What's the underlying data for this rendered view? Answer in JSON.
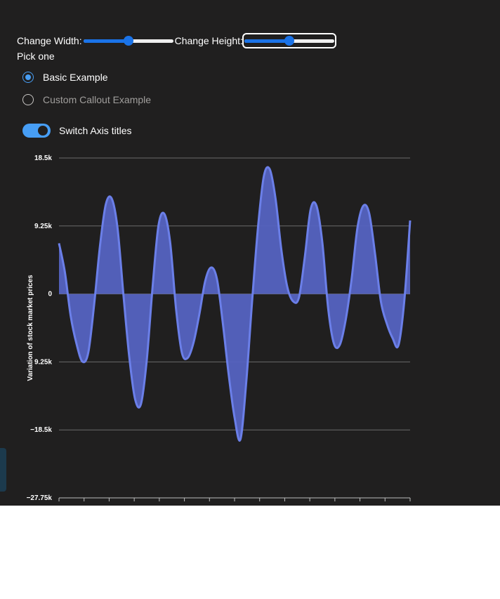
{
  "controls": {
    "width_label": "Change Width:",
    "height_label": "Change Height:",
    "width_value": 0.5,
    "height_value": 0.5
  },
  "pick_label": "Pick one",
  "options": [
    {
      "label": "Basic Example",
      "selected": true
    },
    {
      "label": "Custom Callout Example",
      "selected": false
    }
  ],
  "toggle": {
    "label": "Switch Axis titles",
    "on": true
  },
  "colors": {
    "background": "#201f1f",
    "accent": "#479ef5",
    "series_line": "#6b7fe8",
    "series_fill": "#5563c1",
    "gridline": "#6a6a6a"
  },
  "chart_data": {
    "type": "area",
    "title": "",
    "xlabel": "",
    "ylabel": "Variation of stock market prices",
    "ylim": [
      -27750,
      18500
    ],
    "yticks": [
      18500,
      9250,
      0,
      -9250,
      -18500,
      -27750
    ],
    "ytick_labels": [
      "18.5k",
      "9.25k",
      "0",
      "9.25k",
      "−18.5k",
      "−27.75k"
    ],
    "x": [
      0,
      1,
      2,
      3,
      4,
      5,
      6,
      7,
      8,
      9,
      10,
      11,
      12,
      13,
      14,
      15,
      16,
      17,
      18,
      19,
      20,
      21,
      22,
      23,
      24,
      25,
      26,
      27,
      28,
      29,
      30,
      31,
      32,
      33,
      34,
      35,
      36,
      37,
      38,
      39,
      40,
      41,
      42,
      43,
      44,
      45,
      46,
      47,
      48,
      49,
      50,
      51,
      52,
      53,
      54,
      55,
      56,
      57,
      58,
      59,
      60,
      61,
      62,
      63,
      64,
      65,
      66,
      67,
      68,
      69,
      70,
      71,
      72,
      73,
      74,
      75,
      76,
      77,
      78,
      79,
      80,
      81,
      82,
      83,
      84,
      85,
      86,
      87,
      88,
      89,
      90,
      91,
      92,
      93,
      94,
      95,
      96,
      97,
      98,
      99,
      100
    ],
    "series": [
      {
        "name": "",
        "values": [
          6900,
          3000,
          -3000,
          -6800,
          -9200,
          -8000,
          -1500,
          6500,
          12200,
          13000,
          9000,
          0,
          -8500,
          -14300,
          -15000,
          -9000,
          1000,
          9300,
          10900,
          7000,
          -2000,
          -8000,
          -8700,
          -6600,
          -2700,
          1800,
          3600,
          2000,
          -4000,
          -11000,
          -16800,
          -19800,
          -12000,
          -1000,
          9000,
          16000,
          17000,
          13000,
          6000,
          1000,
          -1000,
          -500,
          5000,
          11500,
          12000,
          7000,
          -2000,
          -6800,
          -6900,
          -3500,
          2000,
          9000,
          12000,
          11000,
          5500,
          -1000,
          -4000,
          -6000,
          -7000,
          -1000,
          10000
        ]
      }
    ]
  }
}
